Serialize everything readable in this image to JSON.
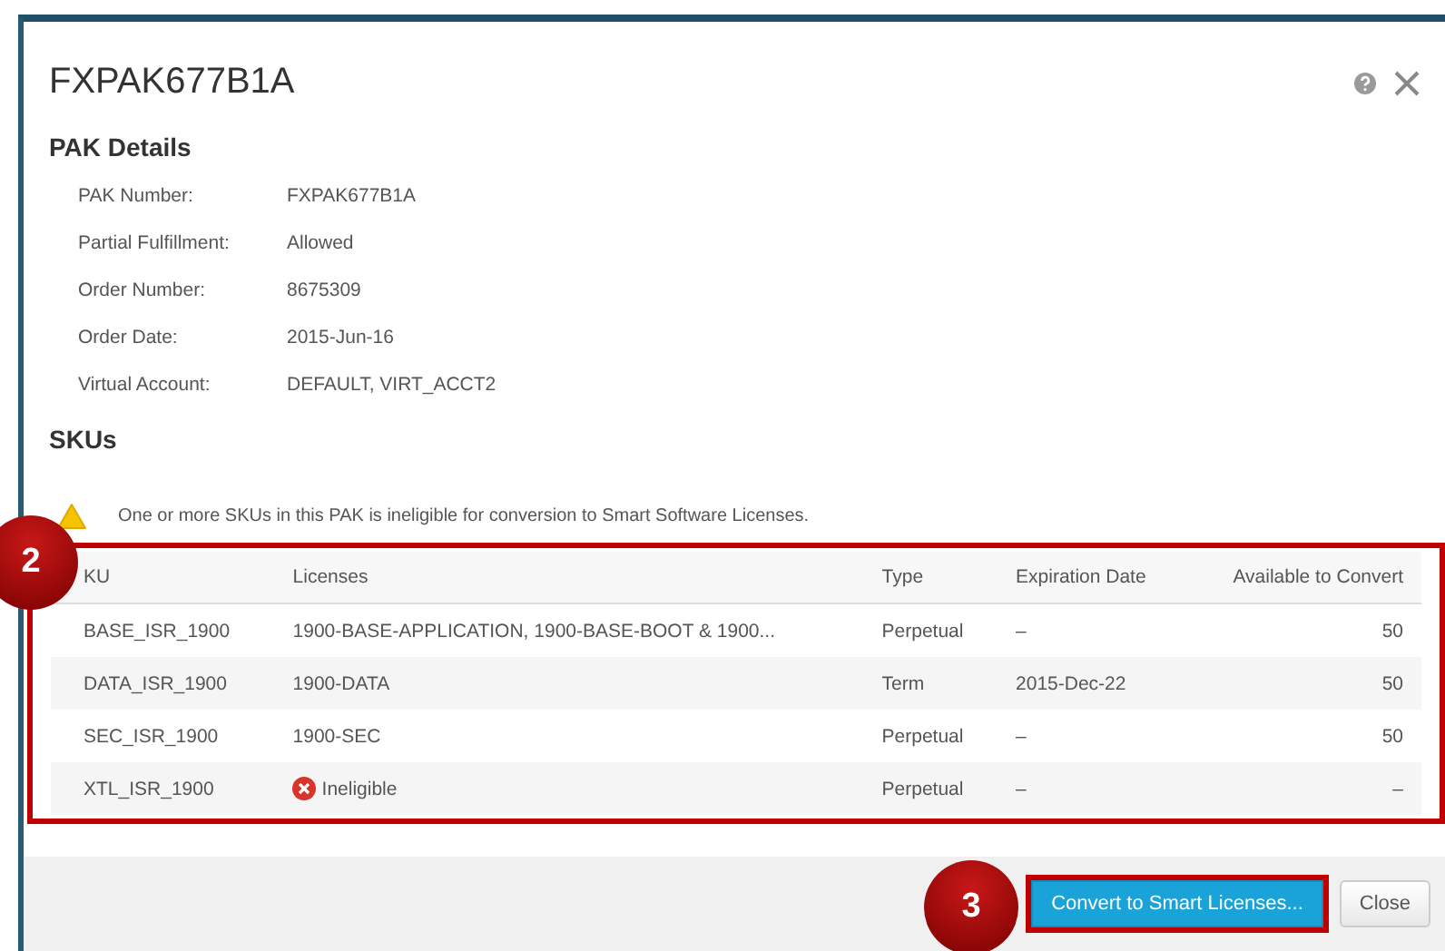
{
  "dialog": {
    "title": "FXPAK677B1A"
  },
  "details": {
    "heading": "PAK Details",
    "fields": [
      {
        "label": "PAK Number:",
        "value": "FXPAK677B1A"
      },
      {
        "label": "Partial Fulfillment:",
        "value": "Allowed"
      },
      {
        "label": "Order Number:",
        "value": "8675309"
      },
      {
        "label": "Order Date:",
        "value": "2015-Jun-16"
      },
      {
        "label": "Virtual Account:",
        "value": "DEFAULT, VIRT_ACCT2"
      }
    ]
  },
  "skus": {
    "heading": "SKUs",
    "warning": "One or more SKUs in this PAK is ineligible for conversion to Smart Software Licenses.",
    "columns": [
      "KU",
      "Licenses",
      "Type",
      "Expiration Date",
      "Available to Convert"
    ],
    "rows": [
      {
        "sku": "BASE_ISR_1900",
        "licenses": "1900-BASE-APPLICATION, 1900-BASE-BOOT & 1900...",
        "eligible": true,
        "type": "Perpetual",
        "expiration": "–",
        "available": "50"
      },
      {
        "sku": "DATA_ISR_1900",
        "licenses": "1900-DATA",
        "eligible": true,
        "type": "Term",
        "expiration": "2015-Dec-22",
        "available": "50"
      },
      {
        "sku": "SEC_ISR_1900",
        "licenses": "1900-SEC",
        "eligible": true,
        "type": "Perpetual",
        "expiration": "–",
        "available": "50"
      },
      {
        "sku": "XTL_ISR_1900",
        "licenses": "Ineligible",
        "eligible": false,
        "type": "Perpetual",
        "expiration": "–",
        "available": "–"
      }
    ]
  },
  "buttons": [
    {
      "label": "Convert to Smart Licenses...",
      "kind": "primary"
    },
    {
      "label": "Close",
      "kind": "secondary"
    }
  ],
  "callouts": [
    {
      "number": "2"
    },
    {
      "number": "3"
    }
  ]
}
